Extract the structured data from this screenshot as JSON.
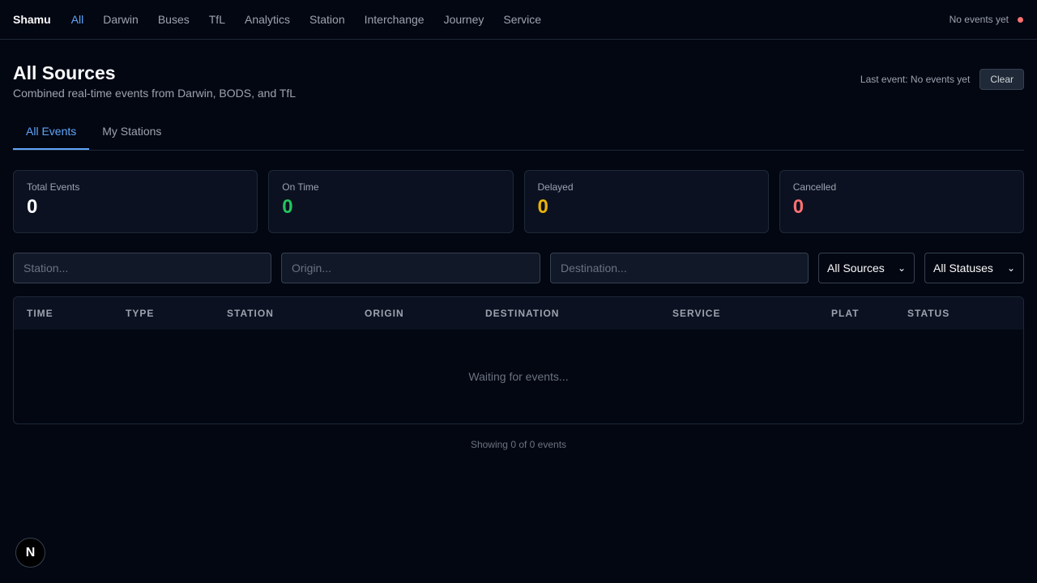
{
  "nav": {
    "brand": "Shamu",
    "links": [
      "All",
      "Darwin",
      "Buses",
      "TfL",
      "Analytics",
      "Station",
      "Interchange",
      "Journey",
      "Service"
    ],
    "active": "All",
    "status_text": "No events yet",
    "status_color": "#f87171"
  },
  "header": {
    "title": "All Sources",
    "subtitle": "Combined real-time events from Darwin, BODS, and TfL",
    "last_event": "Last event: No events yet",
    "clear_label": "Clear"
  },
  "tabs": [
    "All Events",
    "My Stations"
  ],
  "stats": [
    {
      "label": "Total Events",
      "value": "0",
      "color": "#f9fafb"
    },
    {
      "label": "On Time",
      "value": "0",
      "color": "#22c55e"
    },
    {
      "label": "Delayed",
      "value": "0",
      "color": "#eab308"
    },
    {
      "label": "Cancelled",
      "value": "0",
      "color": "#f87171"
    }
  ],
  "filters": {
    "station_placeholder": "Station...",
    "origin_placeholder": "Origin...",
    "destination_placeholder": "Destination...",
    "source_selected": "All Sources",
    "status_selected": "All Statuses"
  },
  "table": {
    "columns": [
      "Time",
      "Type",
      "Station",
      "Origin",
      "Destination",
      "Service",
      "Plat",
      "Status"
    ],
    "empty_text": "Waiting for events...",
    "footer": "Showing 0 of 0 events"
  },
  "badge": {
    "letter": "N",
    "icon": "nextjs-icon"
  },
  "colors": {
    "accent": "#60a5fa",
    "background": "#030712"
  }
}
